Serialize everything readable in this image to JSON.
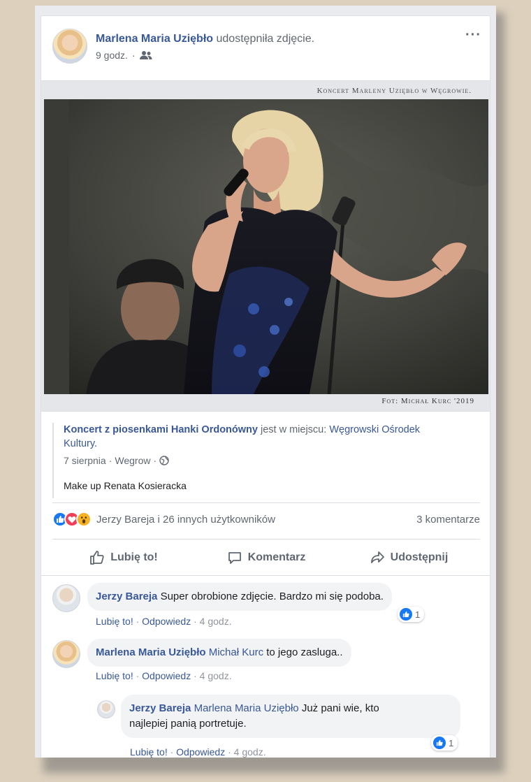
{
  "post": {
    "author": "Marlena Maria Uziębło",
    "action": "udostępniła zdjęcie.",
    "time": "9 godz.",
    "time_sep": "·",
    "more": "···"
  },
  "photo": {
    "caption_top": "Koncert Marleny Uziębło w Węgrowie.",
    "caption_bottom": "Fot: Michał Kurc '2019"
  },
  "place": {
    "event": "Koncert z piosenkami Hanki Ordonówny",
    "connector": "jest w miejscu:",
    "location": "Węgrowski Ośrodek Kultury.",
    "date": "7 sierpnia",
    "sep": "·",
    "city": "Wegrow",
    "description": "Make up Renata Kosieracka"
  },
  "reactions": {
    "summary": "Jerzy Bareja i 26 innych użytkowników",
    "comments_count": "3 komentarze"
  },
  "actions": {
    "like": "Lubię to!",
    "comment": "Komentarz",
    "share": "Udostępnij"
  },
  "comments": [
    {
      "author": "Jerzy Bareja",
      "text": "Super obrobione zdjęcie. Bardzo mi się podoba.",
      "like_label": "Lubię to!",
      "reply_label": "Odpowiedz",
      "time": "4 godz.",
      "likes": "1"
    },
    {
      "author": "Marlena Maria Uziębło",
      "mention": "Michał Kurc",
      "text": "to jego zasluga..",
      "like_label": "Lubię to!",
      "reply_label": "Odpowiedz",
      "time": "4 godz."
    },
    {
      "author": "Jerzy Bareja",
      "mention": "Marlena Maria Uziębło",
      "text_line1": "Już pani wie, kto",
      "text_line2": "najlepiej panią portretuje.",
      "like_label": "Lubię to!",
      "reply_label": "Odpowiedz",
      "time": "4 godz.",
      "likes": "1"
    }
  ],
  "colors": {
    "page_bg": "#ddd0bd",
    "link": "#385898",
    "like_blue": "#1877f2",
    "love_red": "#f33e58",
    "wow_yellow": "#f7b125"
  }
}
